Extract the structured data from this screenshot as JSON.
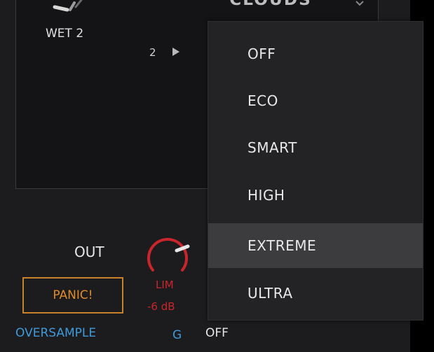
{
  "top": {
    "partial_label": "CLOUDS",
    "wet_label": "WET 2",
    "slot_number": "2"
  },
  "dropdown": {
    "items": [
      "OFF",
      "ECO",
      "SMART",
      "HIGH",
      "EXTREME",
      "ULTRA"
    ],
    "selected": "EXTREME"
  },
  "output": {
    "out_label": "OUT",
    "panic_label": "PANIC!",
    "lim_label": "LIM",
    "lim_value": "-6 dB"
  },
  "oversample": {
    "label": "OVERSAMPLE",
    "glyph": "G",
    "value": "OFF"
  },
  "colors": {
    "panic_accent": "#e08a2a",
    "limiter_red": "#c8262c",
    "oversample_blue": "#3e9ad8",
    "selected_bg": "#3c3c3e"
  }
}
